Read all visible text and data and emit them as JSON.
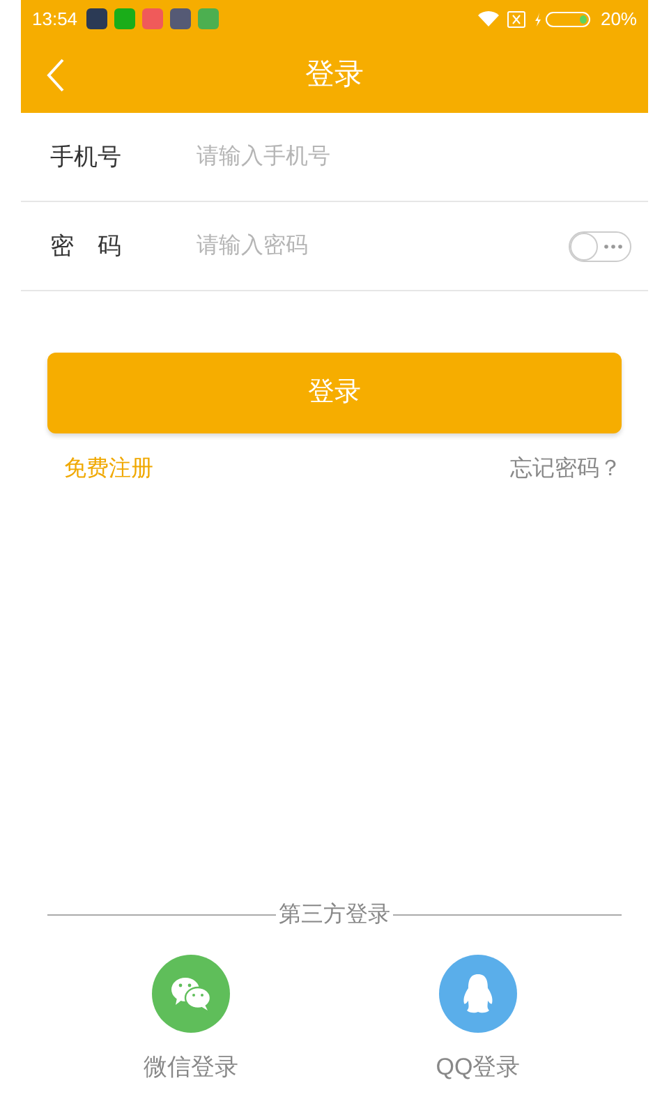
{
  "status_bar": {
    "time": "13:54",
    "battery": "20%"
  },
  "header": {
    "title": "登录"
  },
  "form": {
    "fields": [
      {
        "label": "手机号",
        "placeholder": "请输入手机号",
        "kind": "text"
      },
      {
        "label": "密　码",
        "placeholder": "请输入密码",
        "kind": "password",
        "show_password": false
      }
    ]
  },
  "login_button": "登录",
  "links": {
    "register": "免费注册",
    "forgot": "忘记密码？"
  },
  "third_party": {
    "title": "第三方登录",
    "options": [
      {
        "label": "微信登录",
        "kind": "wechat",
        "color": "#5fbe5a"
      },
      {
        "label": "QQ登录",
        "kind": "qq",
        "color": "#5aaeea"
      }
    ]
  }
}
